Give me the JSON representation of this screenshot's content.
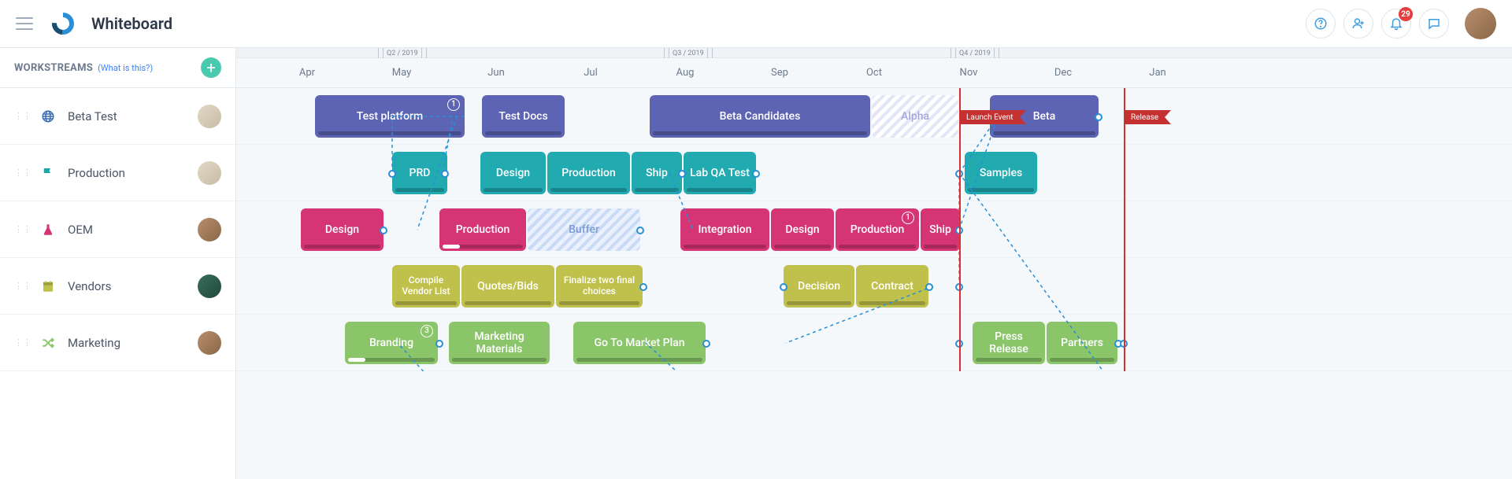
{
  "header": {
    "title": "Whiteboard",
    "notification_count": "29"
  },
  "sidebar": {
    "title": "WORKSTREAMS",
    "help": "(What is this?)"
  },
  "months": [
    "Apr",
    "May",
    "Jun",
    "Jul",
    "Aug",
    "Sep",
    "Oct",
    "Nov",
    "Dec",
    "Jan"
  ],
  "quarters": [
    "Q2 / 2019",
    "Q3 / 2019",
    "Q4 / 2019"
  ],
  "markers": {
    "launch": "Launch Event",
    "release": "Release"
  },
  "rows": [
    {
      "label": "Beta Test",
      "icon": "globe",
      "icon_color": "#3a6db3"
    },
    {
      "label": "Production",
      "icon": "flag",
      "icon_color": "#1fa5a8"
    },
    {
      "label": "OEM",
      "icon": "flask",
      "icon_color": "#d63575"
    },
    {
      "label": "Vendors",
      "icon": "calendar",
      "icon_color": "#c0c14c"
    },
    {
      "label": "Marketing",
      "icon": "shuffle",
      "icon_color": "#8bc56a"
    }
  ],
  "cards": {
    "beta_test_platform": "Test platform",
    "beta_test_docs": "Test Docs",
    "beta_candidates": "Beta Candidates",
    "beta_alpha": "Alpha",
    "beta_beta": "Beta",
    "prod_prd": "PRD",
    "prod_design": "Design",
    "prod_production": "Production",
    "prod_ship": "Ship",
    "prod_labqa": "Lab QA Test",
    "prod_samples": "Samples",
    "oem_design": "Design",
    "oem_production": "Production",
    "oem_buffer": "Buffer",
    "oem_integration": "Integration",
    "oem_design2": "Design",
    "oem_production2": "Production",
    "oem_ship": "Ship",
    "vend_compile": "Compile Vendor List",
    "vend_quotes": "Quotes/Bids",
    "vend_finalize": "Finalize two final choices",
    "vend_decision": "Decision",
    "vend_contract": "Contract",
    "mkt_branding": "Branding",
    "mkt_materials": "Marketing Materials",
    "mkt_gtm": "Go To Market Plan",
    "mkt_press": "Press Release",
    "mkt_partners": "Partners",
    "count_1": "1",
    "count_3": "3"
  },
  "chart_data": {
    "type": "gantt",
    "time_axis": {
      "months": [
        "Apr",
        "May",
        "Jun",
        "Jul",
        "Aug",
        "Sep",
        "Oct",
        "Nov",
        "Dec",
        "Jan"
      ],
      "quarters": [
        "Q2 / 2019",
        "Q3 / 2019",
        "Q4 / 2019"
      ]
    },
    "milestones": [
      {
        "label": "Launch Event",
        "approx_date": "2019-11-05"
      },
      {
        "label": "Release",
        "approx_date": "2020-01-01"
      }
    ],
    "workstreams": [
      {
        "name": "Beta Test",
        "color": "#5d64b3",
        "tasks": [
          {
            "label": "Test platform",
            "start": "2019-04-12",
            "end": "2019-05-25",
            "badge": 1
          },
          {
            "label": "Test Docs",
            "start": "2019-06-01",
            "end": "2019-06-30"
          },
          {
            "label": "Beta Candidates",
            "start": "2019-07-20",
            "end": "2019-10-05"
          },
          {
            "label": "Alpha",
            "start": "2019-10-05",
            "end": "2019-11-05",
            "style": "hatched"
          },
          {
            "label": "Beta",
            "start": "2019-11-12",
            "end": "2019-12-31"
          }
        ]
      },
      {
        "name": "Production",
        "color": "#21aab0",
        "tasks": [
          {
            "label": "PRD",
            "start": "2019-04-25",
            "end": "2019-05-18"
          },
          {
            "label": "Design",
            "start": "2019-05-28",
            "end": "2019-06-20"
          },
          {
            "label": "Production",
            "start": "2019-06-20",
            "end": "2019-07-18"
          },
          {
            "label": "Ship",
            "start": "2019-07-18",
            "end": "2019-08-05"
          },
          {
            "label": "Lab QA Test",
            "start": "2019-08-05",
            "end": "2019-08-28"
          },
          {
            "label": "Samples",
            "start": "2019-11-06",
            "end": "2019-12-01"
          }
        ]
      },
      {
        "name": "OEM",
        "color": "#d63575",
        "tasks": [
          {
            "label": "Design",
            "start": "2019-04-05",
            "end": "2019-05-05",
            "progress": 0
          },
          {
            "label": "Production",
            "start": "2019-05-12",
            "end": "2019-06-10",
            "progress": 20
          },
          {
            "label": "Buffer",
            "start": "2019-06-10",
            "end": "2019-07-20",
            "style": "hatched-blue"
          },
          {
            "label": "Integration",
            "start": "2019-08-05",
            "end": "2019-09-05"
          },
          {
            "label": "Design",
            "start": "2019-09-05",
            "end": "2019-09-25"
          },
          {
            "label": "Production",
            "start": "2019-09-25",
            "end": "2019-10-25",
            "badge": 1
          },
          {
            "label": "Ship",
            "start": "2019-10-25",
            "end": "2019-11-05"
          }
        ]
      },
      {
        "name": "Vendors",
        "color": "#c0c14c",
        "tasks": [
          {
            "label": "Compile Vendor List",
            "start": "2019-04-25",
            "end": "2019-05-20"
          },
          {
            "label": "Quotes/Bids",
            "start": "2019-05-20",
            "end": "2019-06-22"
          },
          {
            "label": "Finalize two final choices",
            "start": "2019-06-22",
            "end": "2019-07-20"
          },
          {
            "label": "Decision",
            "start": "2019-09-10",
            "end": "2019-10-02"
          },
          {
            "label": "Contract",
            "start": "2019-10-02",
            "end": "2019-10-28"
          }
        ]
      },
      {
        "name": "Marketing",
        "color": "#8bc56a",
        "tasks": [
          {
            "label": "Branding",
            "start": "2019-04-18",
            "end": "2019-05-18",
            "badge": 3,
            "progress": 20
          },
          {
            "label": "Marketing Materials",
            "start": "2019-05-20",
            "end": "2019-06-25"
          },
          {
            "label": "Go To Market Plan",
            "start": "2019-06-28",
            "end": "2019-08-10"
          },
          {
            "label": "Press Release",
            "start": "2019-11-08",
            "end": "2019-12-05"
          },
          {
            "label": "Partners",
            "start": "2019-12-05",
            "end": "2019-12-31"
          }
        ]
      }
    ]
  }
}
